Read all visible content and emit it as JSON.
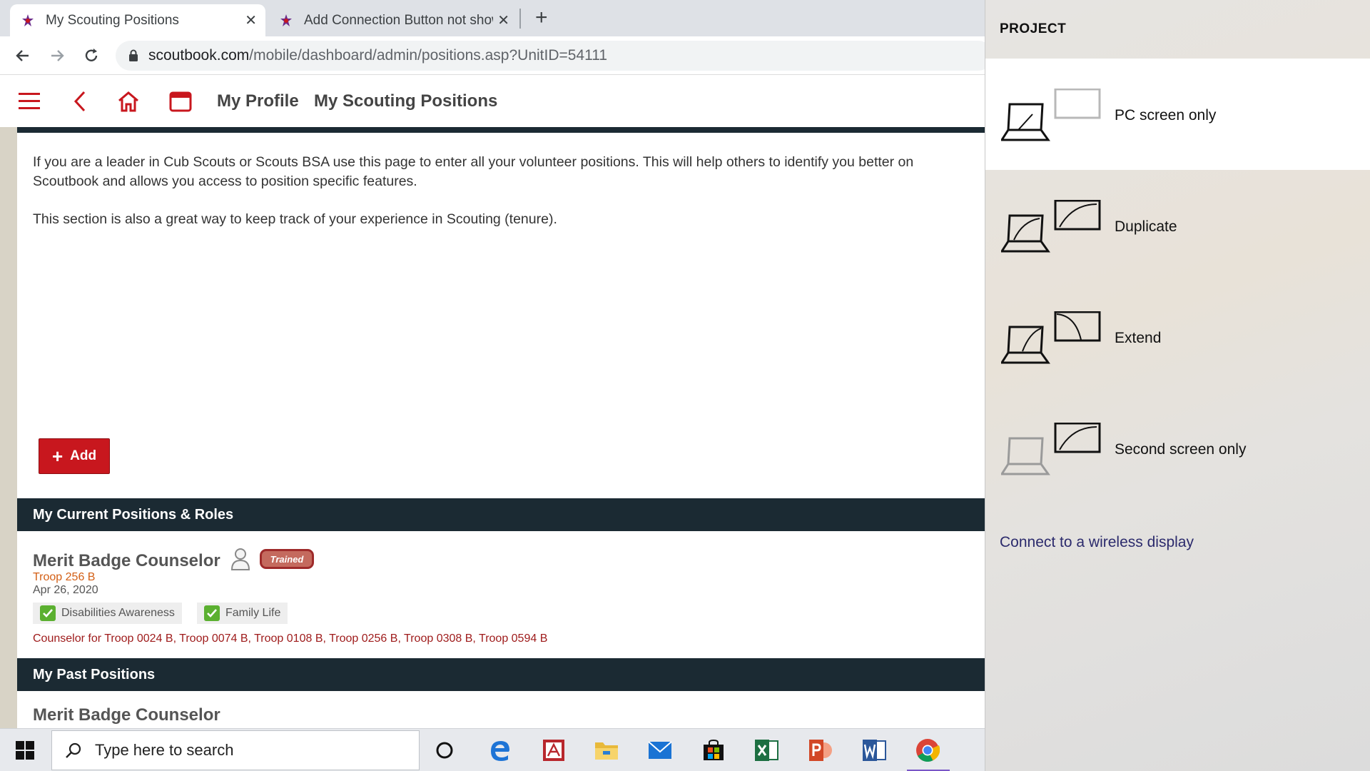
{
  "browser": {
    "tabs": [
      {
        "title": "My Scouting Positions",
        "active": true
      },
      {
        "title": "Add Connection Button not show",
        "active": false
      }
    ],
    "url_host": "scoutbook.com",
    "url_path": "/mobile/dashboard/admin/positions.asp?UnitID=54111"
  },
  "header": {
    "links": [
      "My Profile",
      "My Scouting Positions"
    ]
  },
  "intro": {
    "paragraph1": "If you are a leader in Cub Scouts or Scouts BSA use this page to enter all your volunteer positions. This will help others to identify you better on Scoutbook and allows you access to position specific features.",
    "paragraph2": "This section is also a great way to keep track of your experience in Scouting (tenure)."
  },
  "add_button": {
    "label": "Add"
  },
  "current_section": {
    "title": "My Current Positions & Roles",
    "position": {
      "title": "Merit Badge Counselor",
      "badge": "Trained",
      "unit": "Troop 256 B",
      "date": "Apr 26, 2020",
      "chips": [
        "Disabilities Awareness",
        "Family Life"
      ],
      "counselor_for": "Counselor for Troop 0024 B, Troop 0074 B, Troop 0108 B, Troop 0256 B, Troop 0308 B, Troop 0594 B"
    }
  },
  "past_section": {
    "title": "My Past Positions",
    "position": {
      "title": "Merit Badge Counselor"
    }
  },
  "project_panel": {
    "title": "PROJECT",
    "options": [
      "PC screen only",
      "Duplicate",
      "Extend",
      "Second screen only"
    ],
    "selected": "PC screen only",
    "wireless_link": "Connect to a wireless display"
  },
  "taskbar": {
    "search_placeholder": "Type here to search",
    "apps": [
      "cortana-icon",
      "edge-icon",
      "acrobat-icon",
      "file-explorer-icon",
      "mail-icon",
      "store-icon",
      "excel-icon",
      "powerpoint-icon",
      "word-icon",
      "chrome-icon"
    ]
  },
  "colors": {
    "brand_red": "#c8171e",
    "section_dark": "#1b2a33",
    "unit_orange": "#d35f15",
    "counselor_red": "#9e1a1a",
    "check_green": "#5bb030"
  }
}
